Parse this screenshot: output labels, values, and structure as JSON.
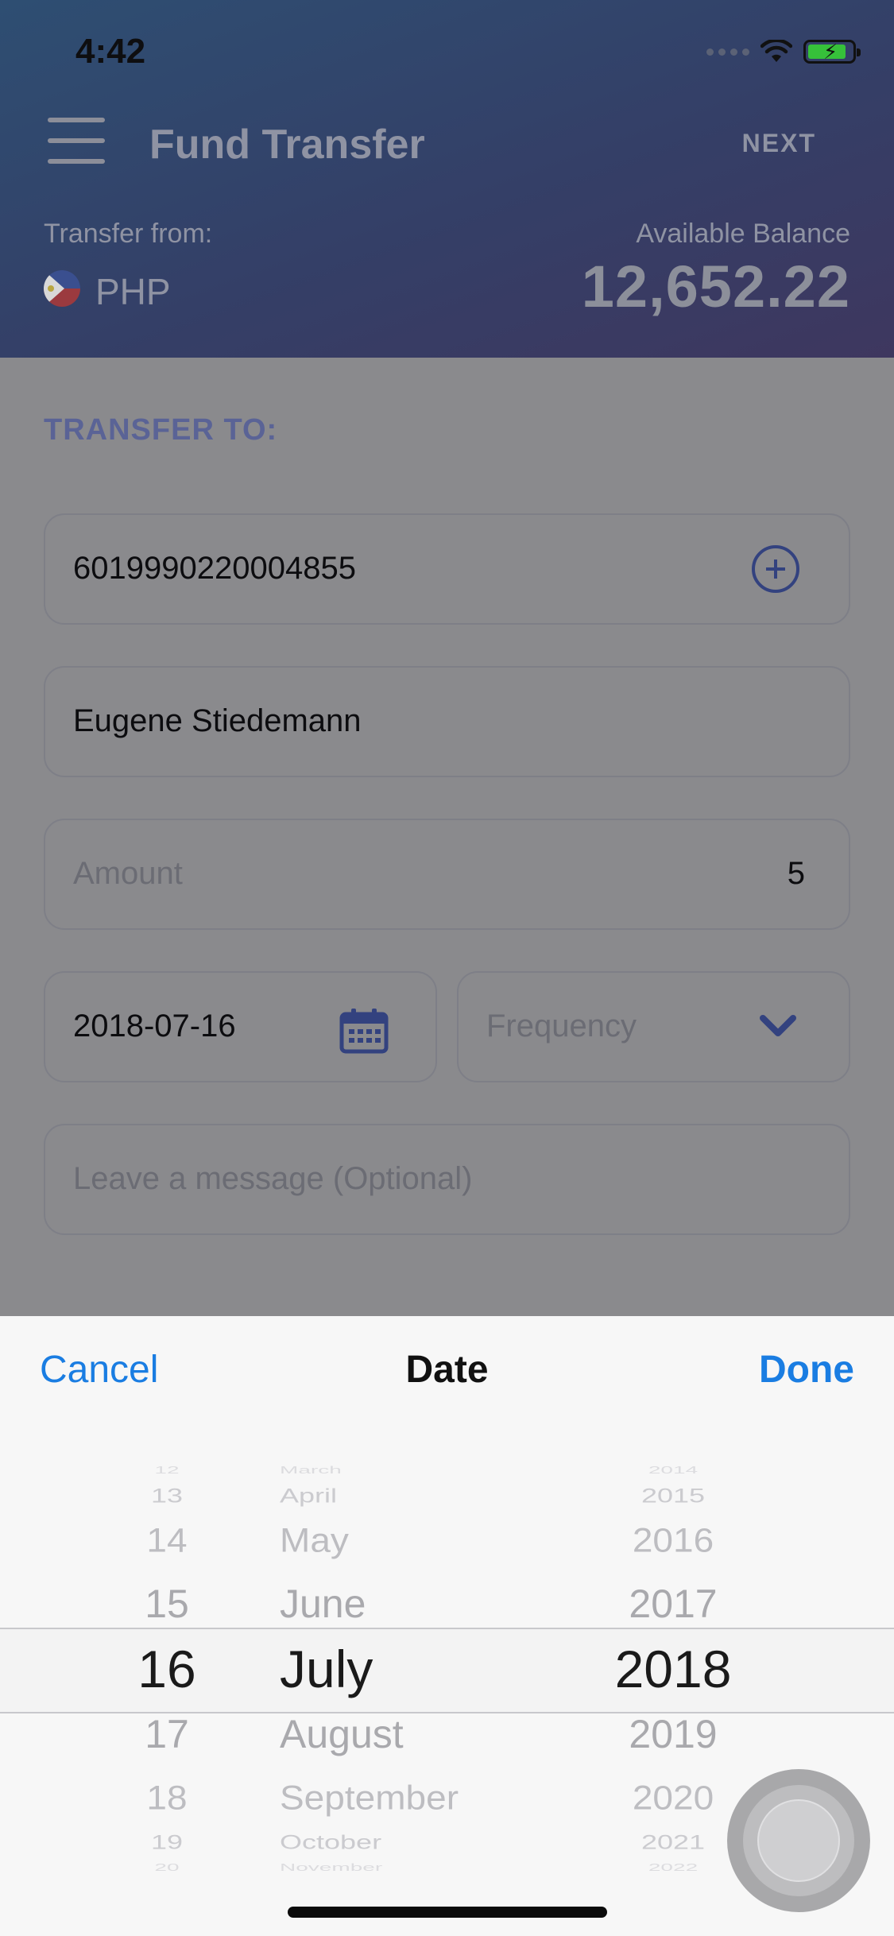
{
  "status_bar": {
    "time": "4:42"
  },
  "header": {
    "title": "Fund Transfer",
    "next_label": "NEXT",
    "transfer_from_label": "Transfer from:",
    "currency": "PHP",
    "available_balance_label": "Available Balance",
    "available_balance": "12,652.22"
  },
  "form": {
    "section_label": "TRANSFER TO:",
    "account_number": "6019990220004855",
    "recipient_name": "Eugene Stiedemann",
    "amount_placeholder": "Amount",
    "amount_value": "5",
    "date_value": "2018-07-16",
    "frequency_placeholder": "Frequency",
    "message_placeholder": "Leave a message (Optional)"
  },
  "picker": {
    "cancel_label": "Cancel",
    "title": "Date",
    "done_label": "Done",
    "days": [
      "12",
      "13",
      "14",
      "15",
      "16",
      "17",
      "18",
      "19",
      "20"
    ],
    "months": [
      "March",
      "April",
      "May",
      "June",
      "July",
      "August",
      "September",
      "October",
      "November"
    ],
    "years": [
      "2014",
      "2015",
      "2016",
      "2017",
      "2018",
      "2019",
      "2020",
      "2021",
      "2022"
    ],
    "selected": {
      "day": "16",
      "month": "July",
      "year": "2018"
    }
  },
  "colors": {
    "accent": "#1a7de2",
    "header_start": "#2e4e72",
    "header_end": "#3e375f",
    "icon_navy": "#33427f",
    "battery_green": "#36c13a"
  }
}
